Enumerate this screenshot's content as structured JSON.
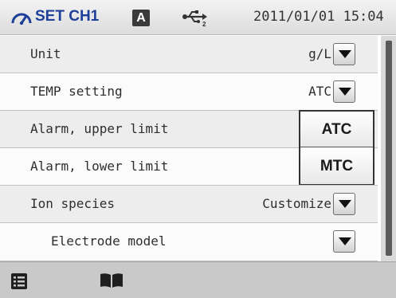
{
  "header": {
    "title": "SET CH1",
    "badge": "A",
    "datetime": "2011/01/01 15:04",
    "icons": [
      "gauge-icon",
      "usb-icon"
    ]
  },
  "rows": [
    {
      "label": "Unit",
      "value": "g/L",
      "has_dropdown": true
    },
    {
      "label": "TEMP setting",
      "value": "ATC",
      "has_dropdown": true
    },
    {
      "label": "Alarm, upper limit",
      "value": "",
      "has_dropdown": false
    },
    {
      "label": "Alarm, lower limit",
      "value": "",
      "has_dropdown": false
    },
    {
      "label": "Ion species",
      "value": "Customize",
      "has_dropdown": true
    },
    {
      "label": "Electrode model",
      "value": "",
      "has_dropdown": true
    }
  ],
  "popup": {
    "options": [
      "ATC",
      "MTC"
    ]
  },
  "footer": {
    "icons": [
      "menu-list-icon",
      "book-icon"
    ]
  },
  "colors": {
    "title": "#1e3f9a",
    "row_alt": "#ededed",
    "footer": "#c9c9c9"
  }
}
